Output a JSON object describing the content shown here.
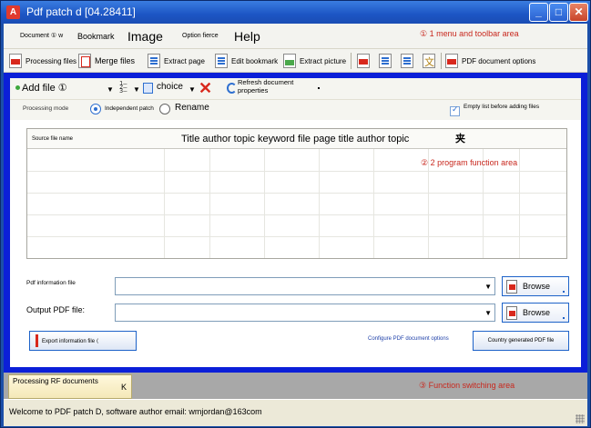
{
  "window": {
    "title": "Pdf patch d [04.28411]",
    "app_icon_label": "A",
    "controls": [
      "minimize",
      "maximize",
      "close"
    ]
  },
  "menubar": {
    "items": [
      {
        "label": "Document ① w"
      },
      {
        "label": "Bookmark"
      },
      {
        "label": "Image"
      },
      {
        "label": "Option fierce"
      },
      {
        "label": "Help"
      }
    ],
    "annotation": "① 1 menu and toolbar area"
  },
  "toolbar": {
    "buttons": [
      {
        "label": "Processing files",
        "icon": "pdf-icon"
      },
      {
        "label": "Merge files",
        "icon": "merge-icon"
      },
      {
        "label": "Extract page",
        "icon": "page-icon"
      },
      {
        "label": "Edit bookmark",
        "icon": "bookmark-icon"
      },
      {
        "label": "Extract picture",
        "icon": "picture-icon"
      },
      {
        "label": "PDF document options",
        "icon": "pdf-icon"
      }
    ]
  },
  "file_panel": {
    "add_file": "Add file ①",
    "choice": "choice",
    "refresh": "Refresh document properties",
    "processing_mode_label": "Processing mode",
    "mode_options": [
      {
        "label": "Independent patch",
        "selected": true
      },
      {
        "label": "Rename",
        "selected": false
      }
    ],
    "empty_list_label": "Empty list before adding files",
    "empty_list_checked": true
  },
  "file_grid": {
    "columns": [
      "Source file name",
      "Title author topic keyword file page title author topic",
      "夹"
    ],
    "annotation": "② 2 program function area",
    "rows": []
  },
  "fields": {
    "pdf_info_label": "Pdf information file",
    "pdf_info_value": "",
    "output_label": "Output PDF file:",
    "output_value": "",
    "browse_label": "Browse"
  },
  "actions": {
    "export_info": "Export information file ⟨",
    "configure_options": "Configure PDF document options",
    "country_generated": "Country generated PDF file"
  },
  "function_switch": {
    "tab_label": "Processing RF documents",
    "close_glyph": "K",
    "annotation": "③ Function switching area"
  },
  "status": {
    "text": "Welcome to PDF patch D, software author email: wmjordan@163com"
  },
  "colors": {
    "titlebar": "#1c55c4",
    "frame_blue": "#0b1fd8",
    "annotation_red": "#c8281e",
    "accent_blue": "#2e6fd0",
    "tab_yellow": "#fff8dc"
  }
}
